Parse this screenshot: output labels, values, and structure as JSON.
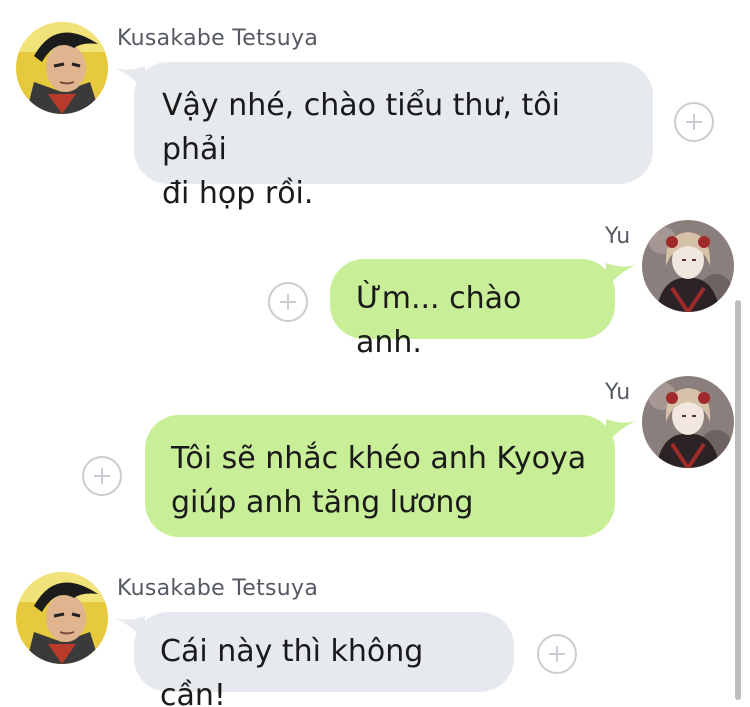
{
  "messages": [
    {
      "sender": "Kusakabe Tetsuya",
      "direction": "incoming",
      "lines": [
        "Vậy nhé, chào tiểu thư, tôi phải",
        "đi họp rồi."
      ],
      "avatar_icon": "kusakabe-avatar-icon"
    },
    {
      "sender": "Yu",
      "direction": "outgoing",
      "lines": [
        "Ừm... chào anh."
      ],
      "avatar_icon": "yu-avatar-icon"
    },
    {
      "sender": "Yu",
      "direction": "outgoing",
      "lines": [
        "Tôi sẽ nhắc khéo anh Kyoya",
        "giúp anh tăng lương"
      ],
      "avatar_icon": "yu-avatar-icon"
    },
    {
      "sender": "Kusakabe Tetsuya",
      "direction": "incoming",
      "lines": [
        "Cái này thì không cần!"
      ],
      "avatar_icon": "kusakabe-avatar-icon"
    }
  ],
  "icons": {
    "add_button": "plus-circle-icon"
  },
  "colors": {
    "incoming_bubble": "#e6e9ee",
    "outgoing_bubble": "#c8ef98",
    "sender_name": "#555a62",
    "add_button_ring": "#c9ccd1"
  }
}
